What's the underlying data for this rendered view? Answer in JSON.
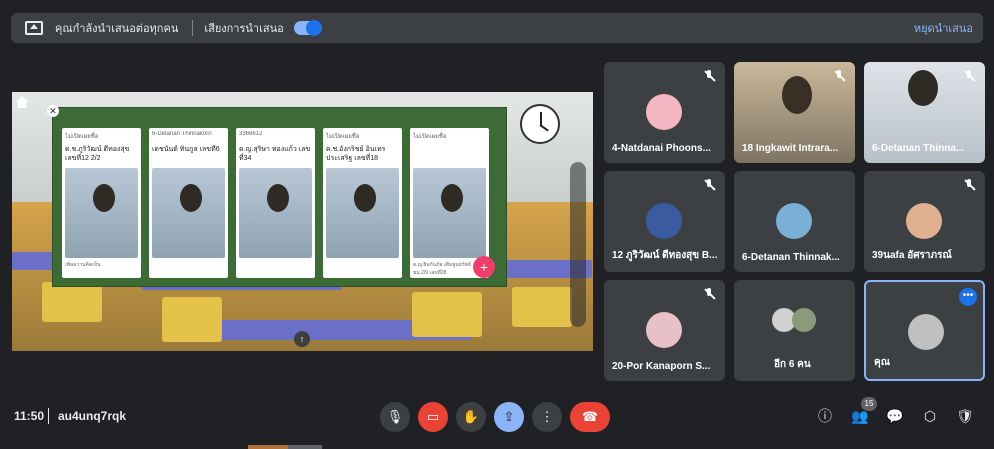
{
  "topbar": {
    "presenting_text": "คุณกำลังนำเสนอต่อทุกคน",
    "audio_label": "เสียงการนำเสนอ",
    "stop_label": "หยุดนำเสนอ"
  },
  "stage": {
    "cards": [
      {
        "header": "ไม่เปิดเผยชื่อ",
        "name": "ด.ช.ภูริวัฒน์ ดีทองสุข เลขที่12 2/2",
        "footer": "เพิ่มความคิดเห็น"
      },
      {
        "header": "6-Detanan Thinnakorn",
        "name": "เดชนันต์ ทินกูล เลขที่6",
        "footer": ""
      },
      {
        "header": "3366612",
        "name": "ด.ญ.สุริษา ทองแก้ว เลขที่34",
        "footer": ""
      },
      {
        "header": "ไม่เปิดเผยชื่อ",
        "name": "ด.ช.อังกริชย์ อินเทร ประเสริฐ เลขที่18",
        "footer": ""
      },
      {
        "header": "ไม่เปิดเผยชื่อ",
        "name": "",
        "footer": "ด.ญ.ยินกันภัส เพิ่มพูนทรัพย์ ชม.2/9 เลขที่28"
      }
    ]
  },
  "participants": [
    {
      "name": "4-Natdanai Phoons...",
      "avatar_color": "#f4b6c2"
    },
    {
      "name": "18 Ingkawit Intrara...",
      "avatar_color": ""
    },
    {
      "name": "6-Detanan Thinna...",
      "avatar_color": ""
    },
    {
      "name": "12 ภูริวัฒน์ ดีทองสุข B...",
      "avatar_color": "#3a5ba0"
    },
    {
      "name": "6-Detanan Thinnak...",
      "avatar_color": "#7ab0d6"
    },
    {
      "name": "39นafa อัศราภรณ์",
      "avatar_color": "#e0b090"
    },
    {
      "name": "20-Por Kanaporn S...",
      "avatar_color": "#e8c0c8"
    },
    {
      "name": "อีก 6 คน",
      "avatar_color": "#d0d0d0"
    },
    {
      "name": "คุณ",
      "avatar_color": "#c0c0c0"
    }
  ],
  "bottom": {
    "time": "11:50",
    "meeting_code": "au4unq7rqk",
    "people_count": "15"
  },
  "colors": {
    "accent": "#8ab4f8",
    "end_call": "#ea4335",
    "background": "#202124"
  }
}
